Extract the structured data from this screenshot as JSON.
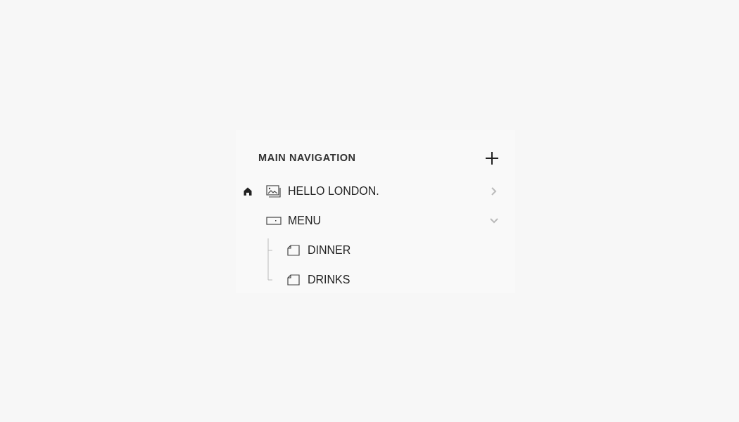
{
  "title": "MAIN NAVIGATION",
  "items": [
    {
      "label": "HELLO LONDON.",
      "kind": "gallery",
      "home": true,
      "expanded": false
    },
    {
      "label": "MENU",
      "kind": "folder",
      "home": false,
      "expanded": true,
      "children": [
        {
          "label": "DINNER",
          "kind": "page"
        },
        {
          "label": "DRINKS",
          "kind": "page"
        }
      ]
    }
  ]
}
